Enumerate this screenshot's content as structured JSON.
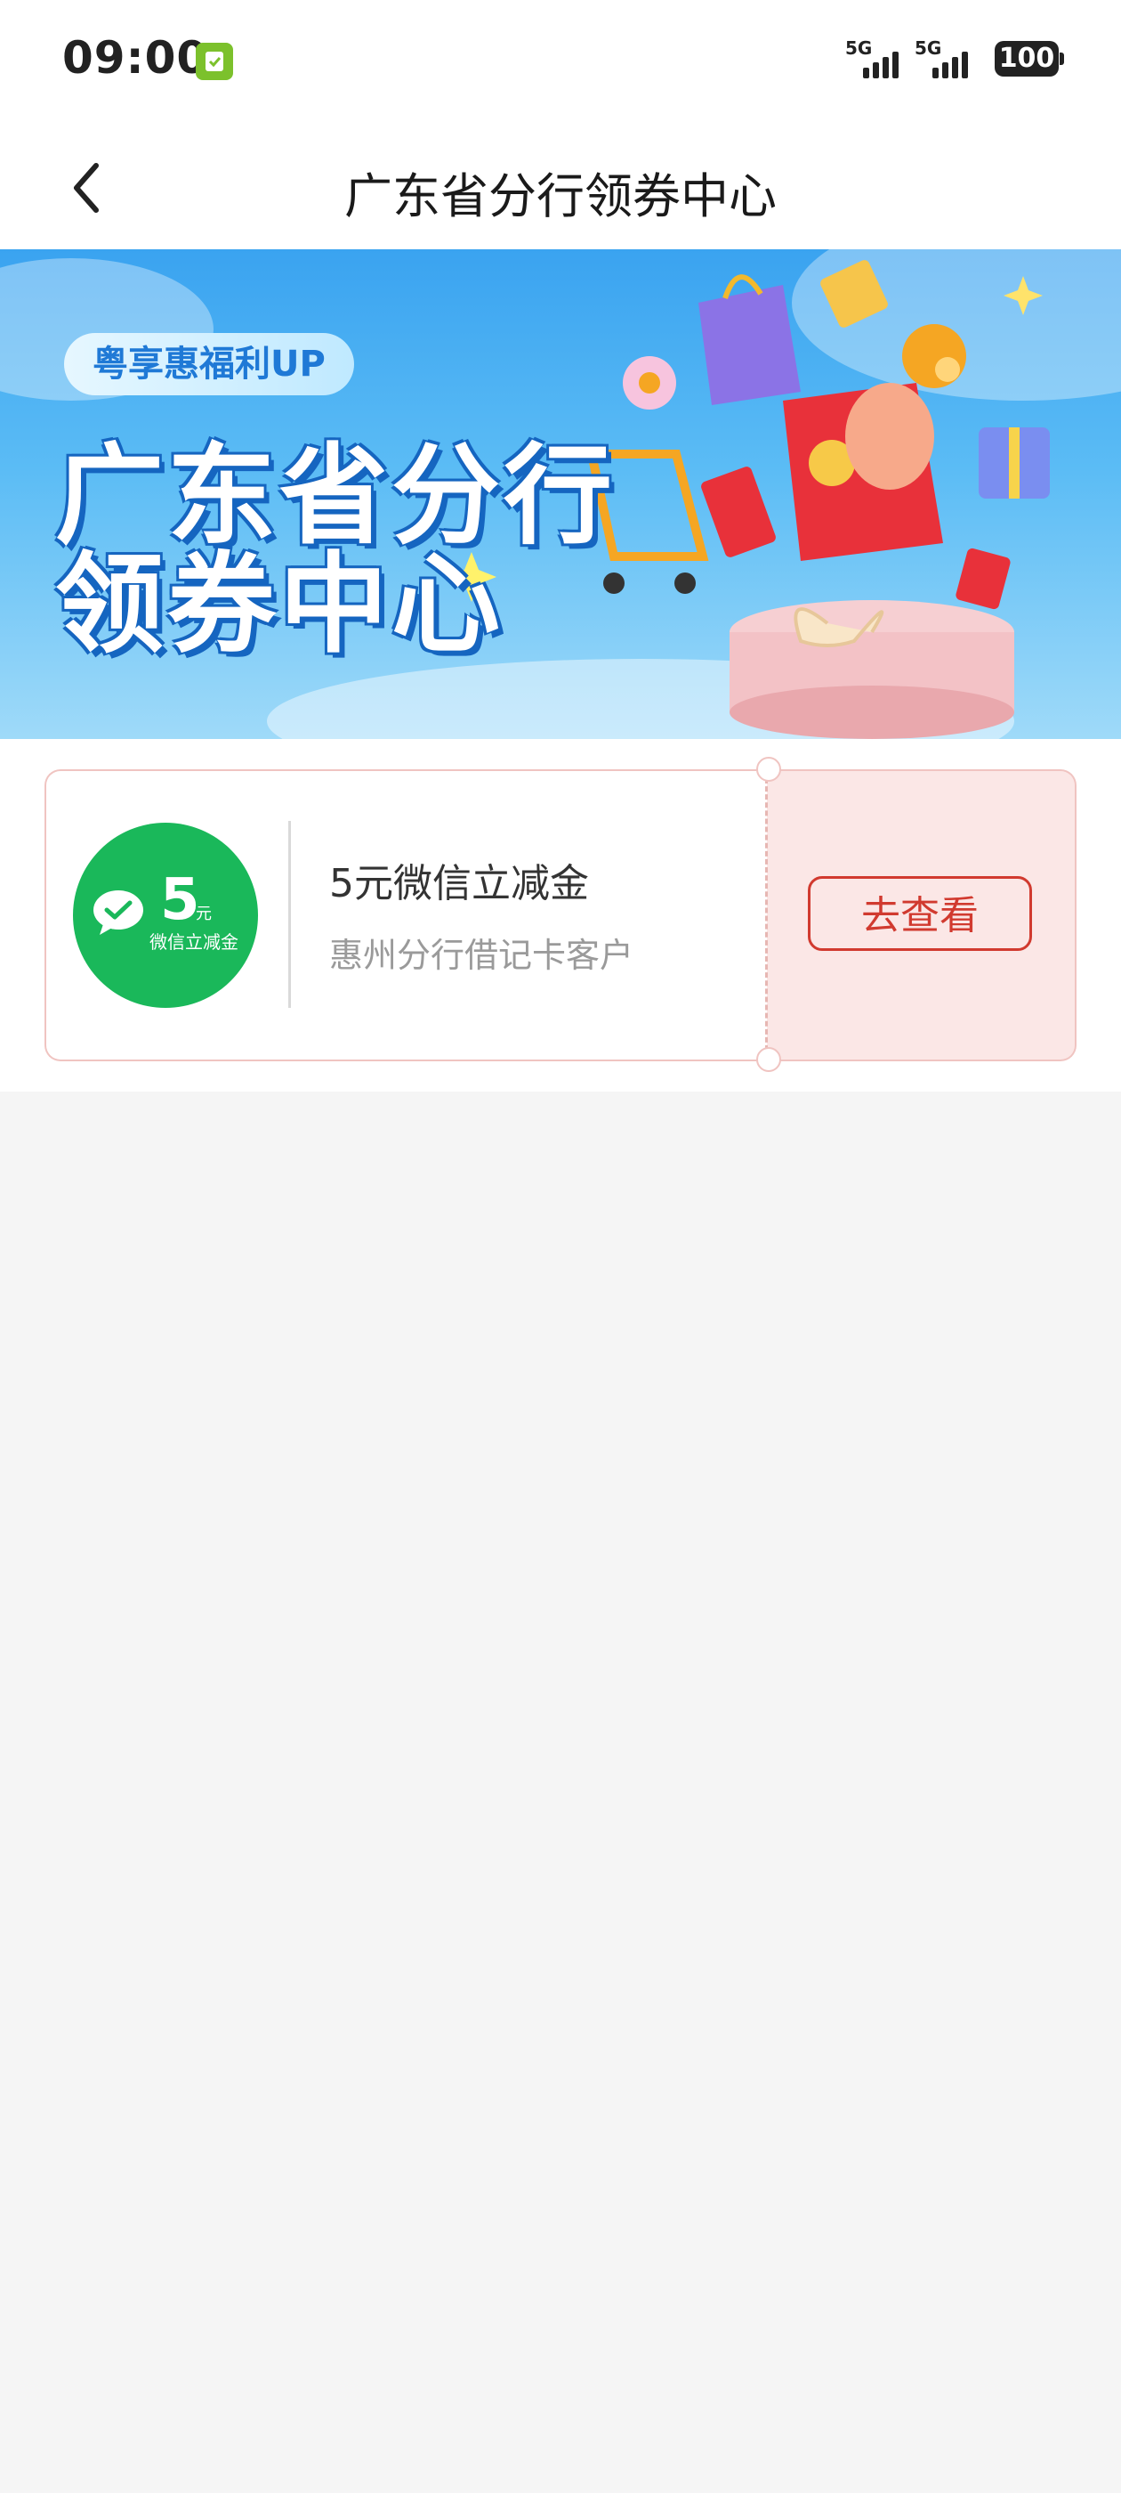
{
  "status_bar": {
    "time": "09:00",
    "signal_1_label": "5G",
    "signal_2_label": "5G",
    "battery": "100"
  },
  "header": {
    "back_icon": "chevron-left-icon",
    "title": "广东省分行领券中心"
  },
  "banner": {
    "tag": "粤享惠福利UP",
    "title_line_1": "广东省分行",
    "title_line_2": "领券中心"
  },
  "coupon": {
    "logo_amount": "5",
    "logo_unit": "元",
    "logo_caption": "微信立减金",
    "title": "5元微信立减金",
    "subtitle": "惠州分行借记卡客户",
    "button_label": "去查看"
  },
  "colors": {
    "accent_red": "#d13a2f",
    "wechat_green": "#1ab85a",
    "coupon_bg": "#fbe7e6"
  }
}
